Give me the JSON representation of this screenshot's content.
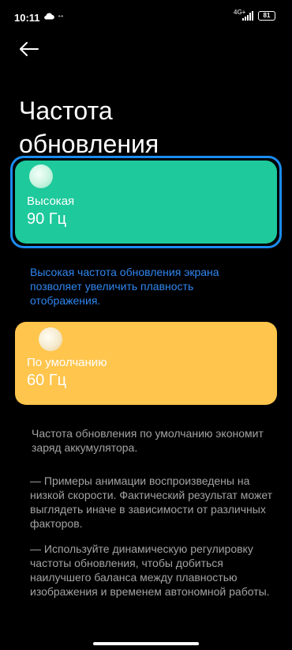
{
  "status_bar": {
    "time": "10:11",
    "data_indicator": "↔",
    "network": "4G+",
    "battery": "81",
    "icons": [
      "cloud-icon",
      "data-transfer-icon",
      "signal-icon",
      "battery-icon"
    ]
  },
  "header": {
    "back_icon": "arrow-left-icon",
    "title": "Частота\nобновления"
  },
  "options": [
    {
      "label": "Высокая",
      "value": "90 Гц",
      "color": "#1ec99c",
      "selected": true
    },
    {
      "label": "По умолчанию",
      "value": "60 Гц",
      "color": "#ffc54d",
      "selected": false
    }
  ],
  "high_description": "Высокая частота обновления экрана позволяет увеличить плавность отображения.",
  "default_description": "Частота обновления по умолчанию экономит заряд аккумулятора.",
  "notes": [
    "— Примеры анимации воспроизведены на низкой скорости. Фактический результат может выглядеть иначе в зависимости от различных факторов.",
    "— Используйте динамическую регулировку частоты обновления, чтобы добиться наилучшего баланса между плавностью изображения и временем автономной работы."
  ],
  "colors": {
    "accent": "#1c8cf0",
    "link_text": "#2f86f0",
    "muted_text": "#a3a3a3"
  }
}
